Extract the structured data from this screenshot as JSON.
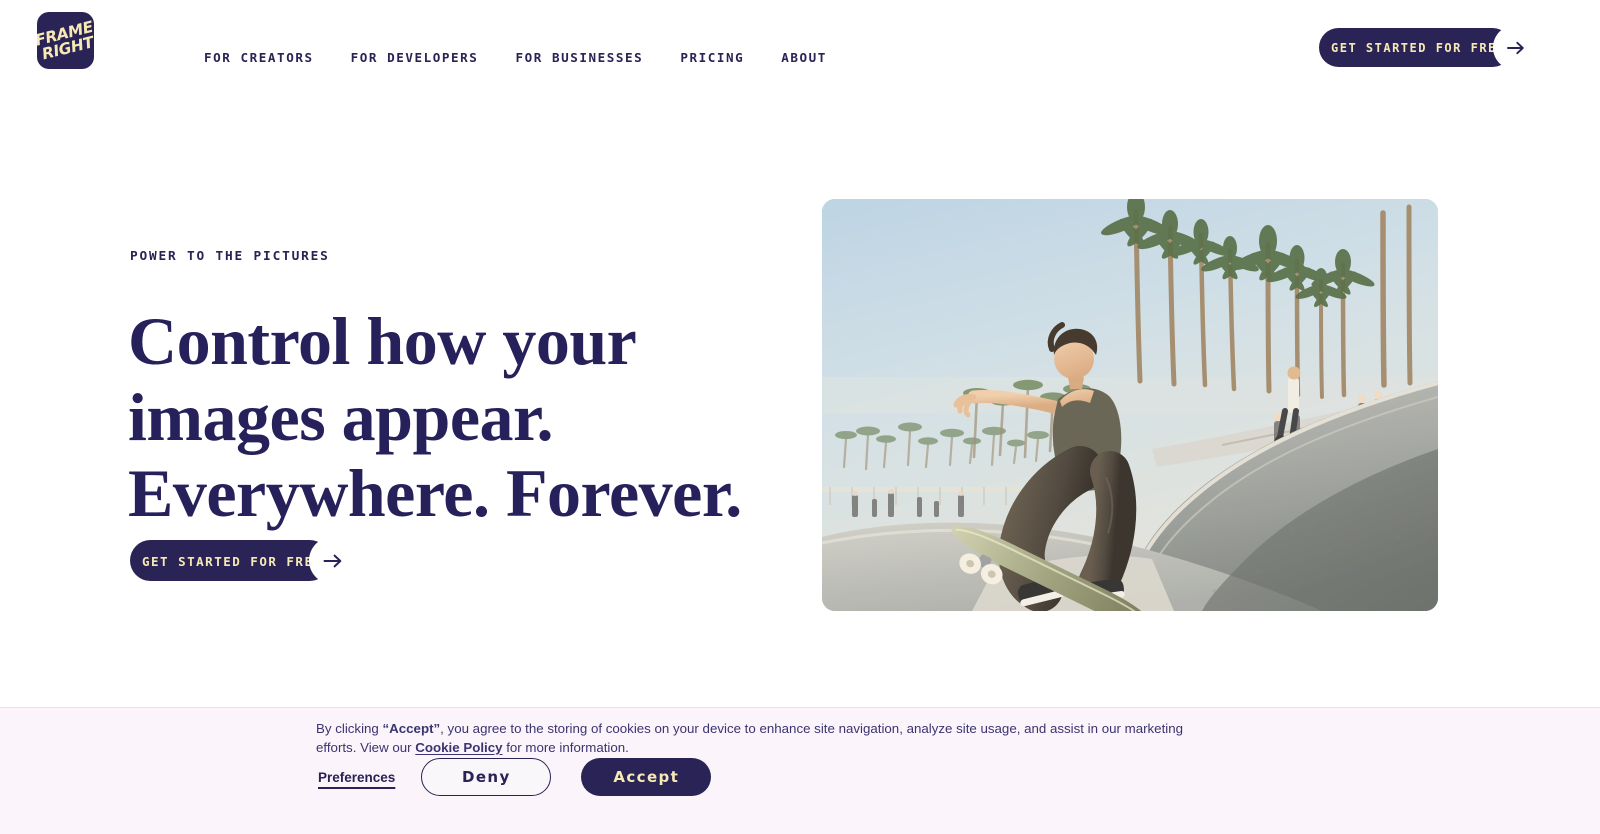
{
  "brand": {
    "logo_text": "FRAME\nRIGHT",
    "logo_name": "Frame Right",
    "navy": "#2a2355",
    "cream": "#f7e9b5",
    "banner_bg": "#fbf4fb"
  },
  "header": {
    "nav": [
      {
        "label": "FOR CREATORS"
      },
      {
        "label": "FOR DEVELOPERS"
      },
      {
        "label": "FOR BUSINESSES"
      },
      {
        "label": "PRICING"
      },
      {
        "label": "ABOUT"
      }
    ],
    "cta_label": "GET STARTED FOR FREE",
    "cta_icon": "arrow-right-icon"
  },
  "hero": {
    "eyebrow": "POWER TO THE PICTURES",
    "title": "Control how your images appear. Everywhere. Forever.",
    "cta_label": "GET STARTED FOR FREE",
    "cta_icon": "arrow-right-icon",
    "image_alt": "Skateboarder riding a concrete bowl at a beachfront skatepark lined with palm trees"
  },
  "cookie_banner": {
    "text_prefix": "By clicking ",
    "accept_quoted": "“Accept”",
    "text_middle": ", you agree to the storing of cookies on your device to enhance site navigation, analyze site usage, and assist in our marketing efforts. View our ",
    "policy_link": "Cookie Policy",
    "text_suffix": " for more information.",
    "preferences_label": "Preferences",
    "deny_label": "Deny",
    "accept_label": "Accept"
  }
}
